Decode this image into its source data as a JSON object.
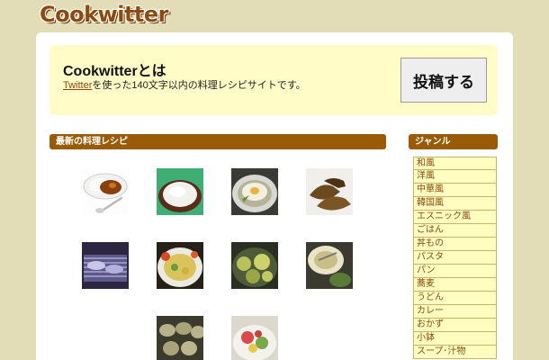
{
  "header": {
    "logo": "Cookwitter"
  },
  "intro": {
    "title": "Cookwitterとは",
    "link_text": "Twitter",
    "description": "を使った140文字以内の料理レシピサイトです。",
    "post_button": "投稿する"
  },
  "recipes": {
    "heading": "最新の料理レシピ",
    "items": [
      {
        "icon": "curry-rice-photo"
      },
      {
        "icon": "grated-daikon-photo"
      },
      {
        "icon": "fried-egg-photo"
      },
      {
        "icon": "grilled-fish-photo"
      },
      {
        "icon": "grill-photo"
      },
      {
        "icon": "stir-fry-photo"
      },
      {
        "icon": "simmered-vegetables-photo"
      },
      {
        "icon": "soup-bowl-photo"
      },
      {
        "icon": "grilled-eggplant-photo"
      },
      {
        "icon": "salad-photo"
      }
    ]
  },
  "genres": {
    "heading": "ジャンル",
    "items": [
      "和風",
      "洋風",
      "中華風",
      "韓国風",
      "エスニック風",
      "ごはん",
      "丼もの",
      "パスタ",
      "パン",
      "蕎麦",
      "うどん",
      "カレー",
      "おかず",
      "小鉢",
      "スープ･汁物"
    ]
  }
}
